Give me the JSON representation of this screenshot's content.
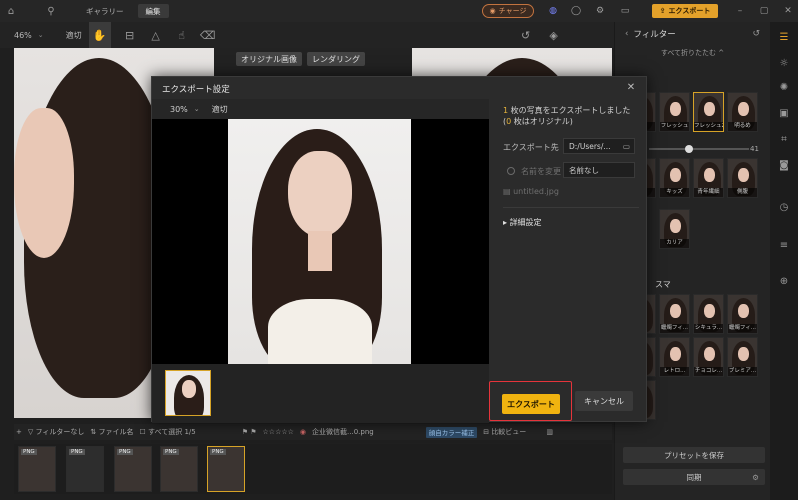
{
  "titlebar": {
    "tabs": [
      "ギャラリー",
      "編集"
    ],
    "active_tab": "編集",
    "charge_label": "チャージ",
    "export_label": "エクスポート"
  },
  "toolbar": {
    "zoom": "46%",
    "fit": "適切"
  },
  "canvas": {
    "original_label": "オリジナル画像",
    "render_label": "レンダリング"
  },
  "rpanel": {
    "title": "フィルター",
    "collapse_all": "すべて折りたたむ ^",
    "slider_value": "41",
    "top_row": [
      "",
      "フレッシュ",
      "フレッシュ2",
      "明るめ"
    ],
    "second_row": [
      "",
      "キッズ",
      "青年繊細",
      "側腹"
    ],
    "third_row": [
      "カリア"
    ],
    "section2_title": "スマ",
    "grid2_row2": [
      "",
      "蠟燭フィ...",
      "シキュラ...",
      "蠟燭フィ..."
    ],
    "grid2_row3": [
      "",
      "レトロ...",
      "チョコレ...",
      "ブレミア..."
    ],
    "save_preset": "プリセットを保存",
    "sync": "同期"
  },
  "bottombar": {
    "filter_none": "フィルターなし",
    "file_name": "ファイル名",
    "select_all": "すべて選択 1/5",
    "filename_text": "企业微信截...0.png",
    "pill": "顔自カラー補正",
    "compare": "比較ビュー"
  },
  "film": {
    "items": [
      "PNG",
      "PNG",
      "PNG",
      "PNG",
      "PNG"
    ]
  },
  "modal": {
    "title": "エクスポート設定",
    "zoom": "30%",
    "fit": "適切",
    "stat_count": "1",
    "stat_text": " 枚の写真をエクスポートしました",
    "stat2_open": "(",
    "stat2_count": "0",
    "stat2_text": " 枚はオリジナル)",
    "dest_label": "エクスポート先",
    "dest_value": "D:/Users/...",
    "rename_label": "名前を変更",
    "rename_value": "名前なし",
    "file_name": "untitled.jpg",
    "advanced": "詳細設定",
    "export_btn": "エクスポート",
    "cancel_btn": "キャンセル"
  }
}
